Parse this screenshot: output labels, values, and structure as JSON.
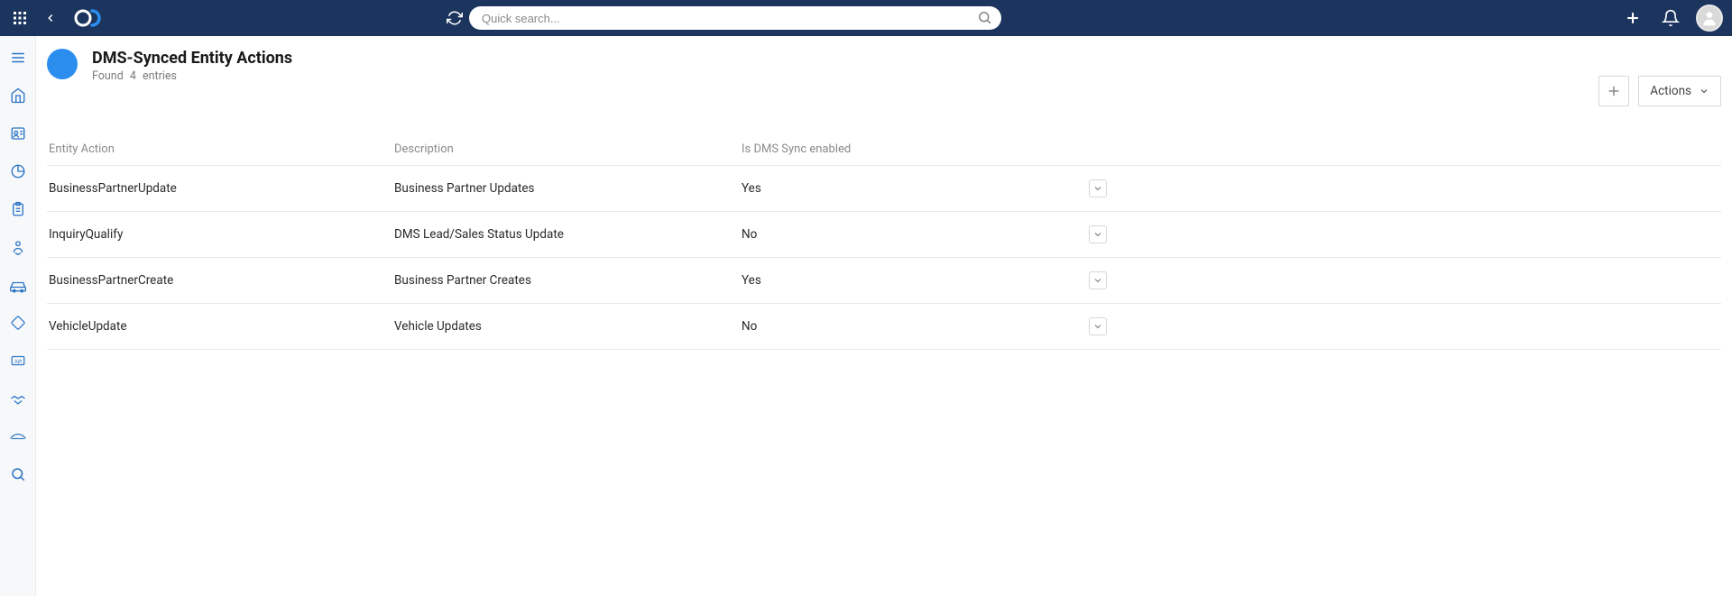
{
  "search": {
    "placeholder": "Quick search..."
  },
  "page": {
    "title": "DMS-Synced Entity Actions",
    "found_label": "Found",
    "count": "4",
    "entries_label": "entries"
  },
  "header_actions": {
    "actions_label": "Actions"
  },
  "table": {
    "headers": {
      "entity_action": "Entity Action",
      "description": "Description",
      "sync_enabled": "Is DMS Sync enabled"
    },
    "rows": [
      {
        "entity_action": "BusinessPartnerUpdate",
        "description": "Business Partner Updates",
        "sync_enabled": "Yes"
      },
      {
        "entity_action": "InquiryQualify",
        "description": "DMS Lead/Sales Status Update",
        "sync_enabled": "No"
      },
      {
        "entity_action": "BusinessPartnerCreate",
        "description": "Business Partner Creates",
        "sync_enabled": "Yes"
      },
      {
        "entity_action": "VehicleUpdate",
        "description": "Vehicle Updates",
        "sync_enabled": "No"
      }
    ]
  }
}
